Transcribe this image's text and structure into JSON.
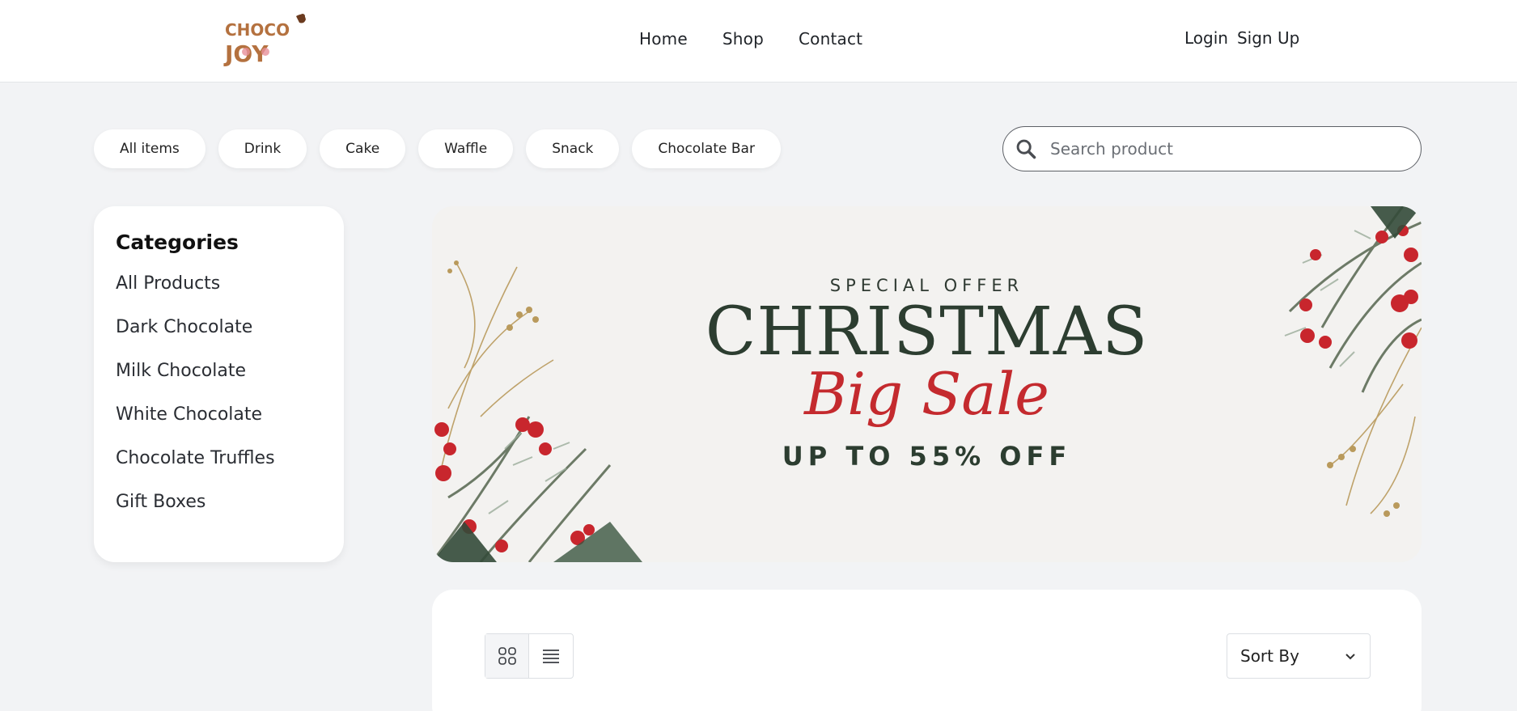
{
  "brand": {
    "logo_text_top": "CHOCO",
    "logo_text_bottom": "JOY"
  },
  "nav": {
    "items": [
      "Home",
      "Shop",
      "Contact"
    ]
  },
  "auth": {
    "login": "Login",
    "signup": "Sign Up"
  },
  "filters": [
    "All items",
    "Drink",
    "Cake",
    "Waffle",
    "Snack",
    "Chocolate Bar"
  ],
  "search": {
    "placeholder": "Search product",
    "icon": "search-icon"
  },
  "sidebar": {
    "title": "Categories",
    "items": [
      "All Products",
      "Dark Chocolate",
      "Milk Chocolate",
      "White Chocolate",
      "Chocolate Truffles",
      "Gift Boxes"
    ]
  },
  "banner": {
    "special": "SPECIAL OFFER",
    "headline": "CHRISTMAS",
    "subheadline": "Big Sale",
    "offer": "UP TO 55% OFF"
  },
  "toolbar": {
    "sort_label": "Sort By",
    "grid_icon": "grid-view-icon",
    "list_icon": "list-view-icon"
  },
  "colors": {
    "brand_brown": "#b4713f",
    "brand_pink": "#e7909a",
    "headline_green": "#2c3d30",
    "sale_red": "#c42a2e",
    "background": "#f2f3f5"
  }
}
